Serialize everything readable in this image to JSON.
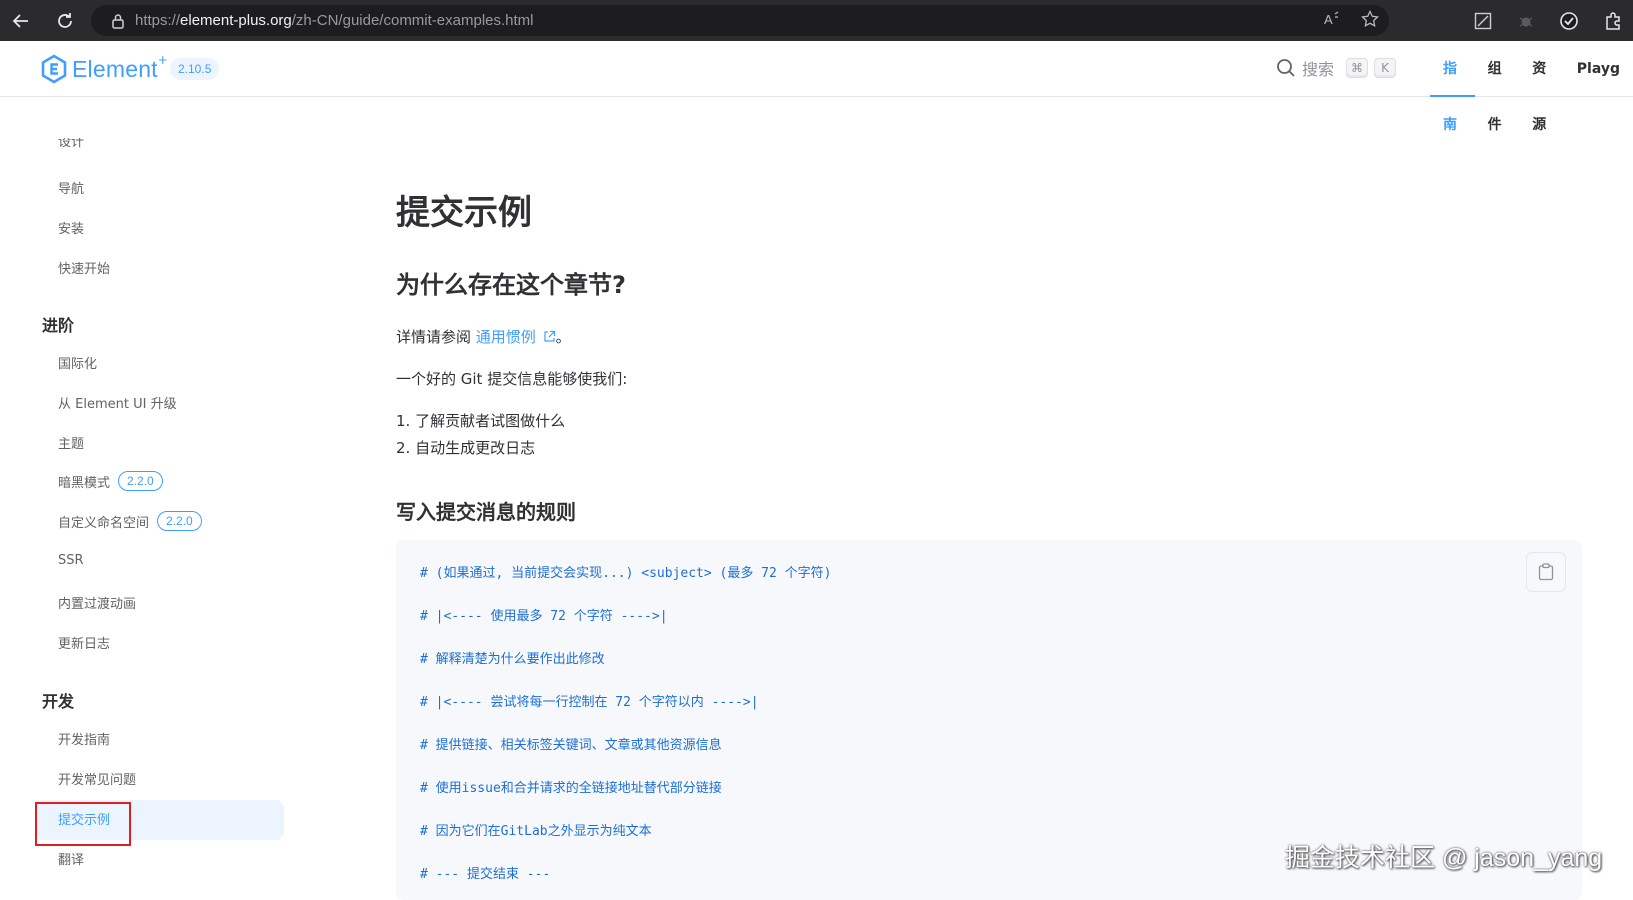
{
  "browser": {
    "url_prefix": "https://",
    "url_host": "element-plus.org",
    "url_path": "/zh-CN/guide/commit-examples.html"
  },
  "header": {
    "logo_text": "Element",
    "logo_sup": "+",
    "version": "2.10.5",
    "search_label": "搜索",
    "search_key_cmd": "⌘",
    "search_key_k": "K",
    "nav": [
      "指南",
      "组件",
      "资源",
      "Playg"
    ]
  },
  "sidebar": {
    "partial_item": "设计",
    "items_basic": [
      "导航",
      "安装",
      "快速开始"
    ],
    "group_advanced": "进阶",
    "items_advanced": [
      "国际化",
      "从 Element UI 升级",
      "主题",
      "暗黑模式",
      "自定义命名空间",
      "SSR",
      "内置过渡动画",
      "更新日志"
    ],
    "tag_dark": "2.2.0",
    "tag_namespace": "2.2.0",
    "group_dev": "开发",
    "items_dev": [
      "开发指南",
      "开发常见问题",
      "提交示例",
      "翻译"
    ]
  },
  "main": {
    "title": "提交示例",
    "h2": "为什么存在这个章节?",
    "p1_text": "详情请参阅 ",
    "p1_link": "通用惯例",
    "p1_end": "。",
    "p2": "一个好的 Git 提交信息能够使我们:",
    "list": [
      "1. 了解贡献者试图做什么",
      "2. 自动生成更改日志"
    ],
    "h3": "写入提交消息的规则",
    "code": [
      "# (如果通过, 当前提交会实现...) <subject> (最多 72 个字符)",
      "# |<---- 使用最多 72 个字符 ---->|",
      "# 解释清楚为什么要作出此修改",
      "# |<---- 尝试将每一行控制在 72 个字符以内 ---->|",
      "# 提供链接、相关标签关键词、文章或其他资源信息",
      "# 使用issue和合并请求的全链接地址替代部分链接",
      "# 因为它们在GitLab之外显示为纯文本",
      "# --- 提交结束 ---"
    ]
  },
  "watermark": "掘金技术社区 @ jason_yang"
}
